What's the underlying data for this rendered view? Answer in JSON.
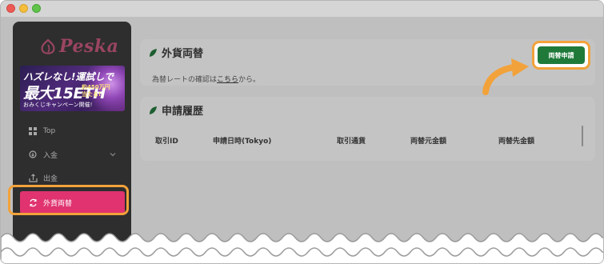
{
  "window": {
    "traffic_lights": [
      "close",
      "minimize",
      "maximize"
    ]
  },
  "sidebar": {
    "logo_text": "Peska",
    "banner": {
      "line1": "ハズレなし!運試しで",
      "line2": "最大15ETH",
      "sub": "約450万円 当たる!",
      "line3": "おみくじキャンペーン開催!"
    },
    "items": [
      {
        "label": "Top",
        "icon": "grid-icon"
      },
      {
        "label": "入金",
        "icon": "deposit-icon",
        "has_chevron": true
      },
      {
        "label": "出金",
        "icon": "withdraw-icon"
      },
      {
        "label": "外貨両替",
        "icon": "exchange-icon",
        "active": true
      }
    ]
  },
  "main": {
    "exchange_panel": {
      "title": "外貨両替",
      "text_prefix": "為替レートの確認は",
      "link": "こちら",
      "text_suffix": "から。"
    },
    "history_panel": {
      "title": "申請履歴",
      "columns": [
        "取引ID",
        "申請日時(Tokyo)",
        "取引通貨",
        "両替元金額",
        "両替先金額"
      ]
    },
    "apply_button": "両替申請"
  },
  "colors": {
    "accent_pink": "#e0336f",
    "highlight_orange": "#f2a23a",
    "button_green": "#1f7a3a"
  }
}
